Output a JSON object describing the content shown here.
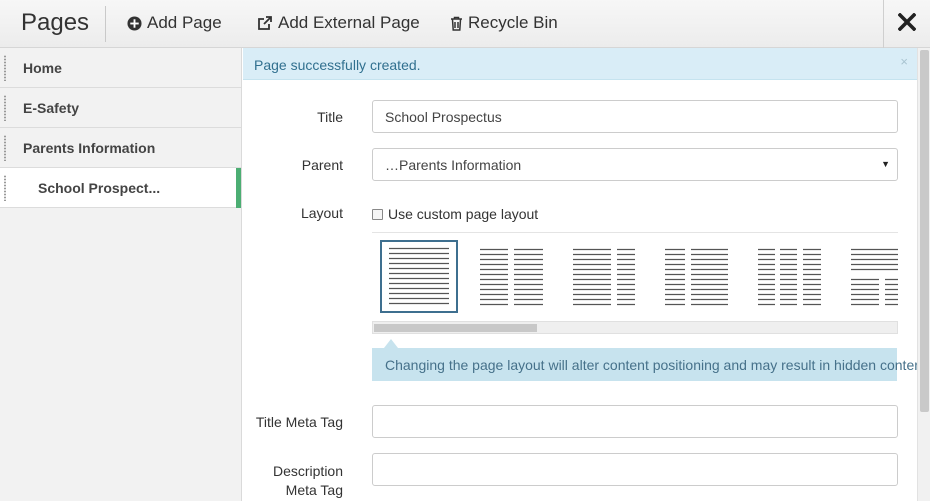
{
  "header": {
    "title": "Pages",
    "add_page": "Add Page",
    "add_external_page": "Add External Page",
    "recycle_bin": "Recycle Bin",
    "icons": {
      "add": "plus-circle-icon",
      "external": "external-link-icon",
      "bin": "trash-icon",
      "close": "close-icon"
    }
  },
  "sidebar": {
    "items": [
      {
        "label": "Home"
      },
      {
        "label": "E-Safety"
      },
      {
        "label": "Parents Information"
      },
      {
        "label": "School Prospect...",
        "active": true
      }
    ],
    "accent_color": "#4cae73"
  },
  "alert": {
    "message": "Page successfully created.",
    "close": "×"
  },
  "form": {
    "title_label": "Title",
    "title_value": "School Prospectus",
    "parent_label": "Parent",
    "parent_value": "…Parents Information",
    "layout_label": "Layout",
    "custom_layout_label": "Use custom page layout",
    "custom_layout_checked": false,
    "layout_options": [
      "single-column",
      "two-column-left",
      "two-column-right",
      "two-column-even",
      "three-column",
      "header-two-column"
    ],
    "selected_layout": 0,
    "layout_warning": "Changing the page layout will alter content positioning and may result in hidden content.",
    "title_meta_label": "Title Meta Tag",
    "title_meta_value": "",
    "description_meta_label_line1": "Description",
    "description_meta_label_line2": "Meta Tag",
    "description_meta_value": ""
  },
  "colors": {
    "alert_bg": "#d9edf7",
    "alert_text": "#31708f",
    "info_bg": "#c7e3ee",
    "selected_layout_border": "#3e6f8f"
  }
}
